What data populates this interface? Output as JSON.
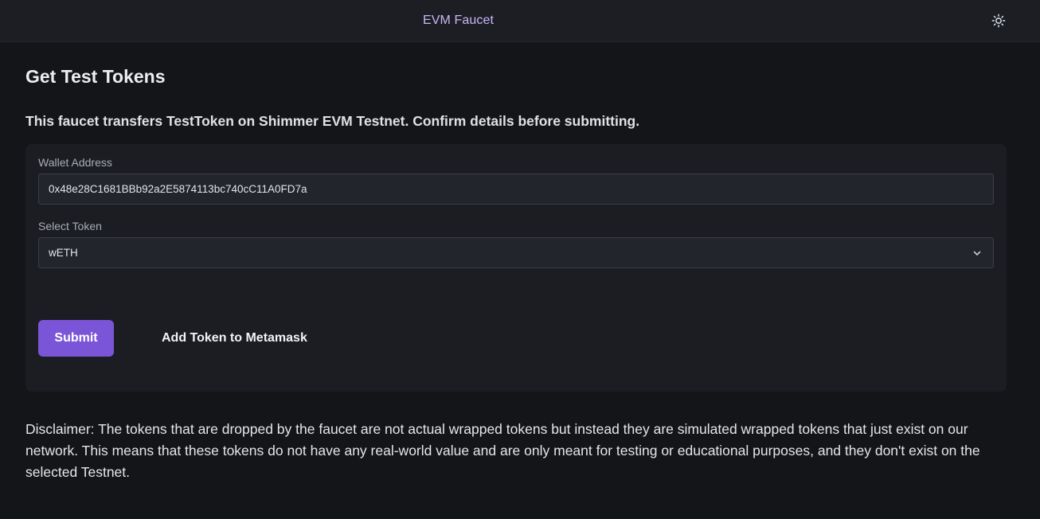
{
  "header": {
    "title": "EVM Faucet",
    "theme_toggle_icon": "sun-icon"
  },
  "main": {
    "heading": "Get Test Tokens",
    "intro": "This faucet transfers TestToken on Shimmer EVM Testnet. Confirm details before submitting.",
    "form": {
      "wallet_label": "Wallet Address",
      "wallet_value": "0x48e28C1681BBb92a2E5874113bc740cC11A0FD7a",
      "token_label": "Select Token",
      "token_selected": "wETH",
      "submit_label": "Submit",
      "add_token_label": "Add Token to Metamask"
    },
    "disclaimer": "Disclaimer: The tokens that are dropped by the faucet are not actual wrapped tokens but instead they are simulated wrapped tokens that just exist on our network. This means that these tokens do not have any real-world value and are only meant for testing or educational purposes, and they don't exist on the selected Testnet."
  },
  "colors": {
    "background": "#141519",
    "header_bg": "#1c1e24",
    "card_bg": "#1b1d23",
    "accent": "#7b55d8",
    "title_accent": "#c9b6f5"
  }
}
